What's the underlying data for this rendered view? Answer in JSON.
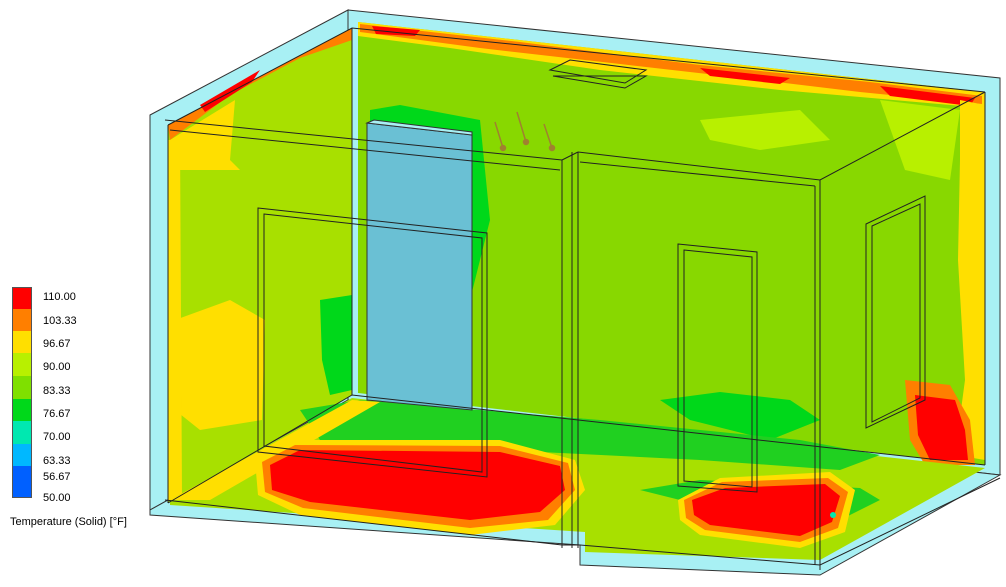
{
  "legend": {
    "title": "Temperature (Solid) [°F]",
    "ticks": [
      "110.00",
      "103.33",
      "96.67",
      "90.00",
      "83.33",
      "76.67",
      "70.00",
      "63.33",
      "56.67",
      "50.00"
    ],
    "colors": [
      "#ff0000",
      "#ff7f00",
      "#ffdf00",
      "#b8f000",
      "#7fe000",
      "#00d81a",
      "#00e8b0",
      "#00b8ff",
      "#0060ff",
      "#0000ff"
    ]
  },
  "colors": {
    "background": "#ffffff",
    "glass": "#a8f0f4",
    "door": "#6ac0d4",
    "hot": "#ff0000",
    "warm": "#ff8000",
    "yellow": "#f0f000",
    "yellowgreen": "#a8e000",
    "green": "#88d800",
    "bright_green": "#20d020"
  }
}
